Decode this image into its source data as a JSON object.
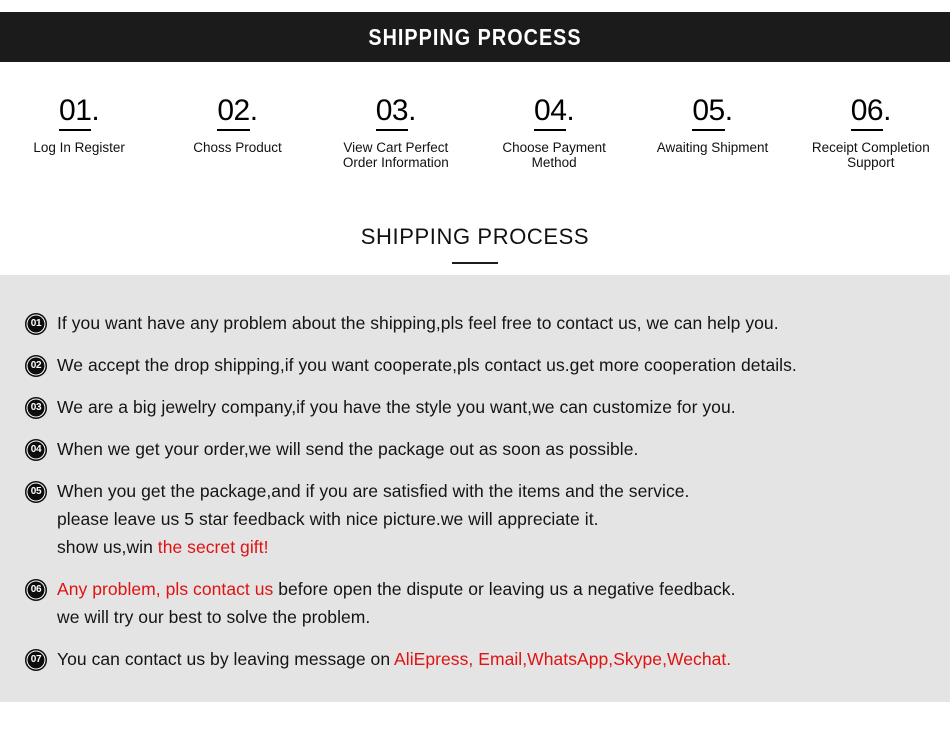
{
  "banner": {
    "title": "SHIPPING PROCESS"
  },
  "steps": [
    {
      "number": "01",
      "dot": ".",
      "label": "Log In Register"
    },
    {
      "number": "02",
      "dot": ".",
      "label": "Choss Product"
    },
    {
      "number": "03",
      "dot": ".",
      "label": "View Cart Perfect\nOrder Information"
    },
    {
      "number": "04",
      "dot": ".",
      "label": "Choose Payment\nMethod"
    },
    {
      "number": "05",
      "dot": ".",
      "label": "Awaiting Shipment"
    },
    {
      "number": "06",
      "dot": ".",
      "label": "Receipt Completion\nSupport"
    }
  ],
  "section": {
    "subtitle": "SHIPPING PROCESS"
  },
  "colors": {
    "banner_background": "#1b1b1b",
    "panel_background": "#e4e4e4",
    "accent_red": "#e01212",
    "badge_background": "#0d0d0d"
  },
  "notes": [
    {
      "badge": "01",
      "lines": [
        [
          {
            "text": "If you want have any problem about the shipping,pls feel free to contact us, we can help you.",
            "color": "black"
          }
        ]
      ]
    },
    {
      "badge": "02",
      "lines": [
        [
          {
            "text": "We accept the drop shipping,if you want cooperate,pls contact us.get more cooperation details.",
            "color": "black"
          }
        ]
      ]
    },
    {
      "badge": "03",
      "lines": [
        [
          {
            "text": "We are a big jewelry company,if you have the style you want,we can customize for you.",
            "color": "black"
          }
        ]
      ]
    },
    {
      "badge": "04",
      "lines": [
        [
          {
            "text": "When we get your order,we will send the package out as soon as possible.",
            "color": "black"
          }
        ]
      ]
    },
    {
      "badge": "05",
      "lines": [
        [
          {
            "text": "When you get the package,and if you are satisfied with the items and the service.",
            "color": "black"
          }
        ],
        [
          {
            "text": "please leave us 5 star feedback with nice picture.we will appreciate it.",
            "color": "black"
          }
        ],
        [
          {
            "text": "show us,win ",
            "color": "black"
          },
          {
            "text": "the secret gift!",
            "color": "red"
          }
        ]
      ]
    },
    {
      "badge": "06",
      "lines": [
        [
          {
            "text": "Any problem, pls contact us",
            "color": "red"
          },
          {
            "text": " before open the dispute or leaving us a negative feedback.",
            "color": "black"
          }
        ],
        [
          {
            "text": "we will try our best to solve the problem.",
            "color": "black"
          }
        ]
      ]
    },
    {
      "badge": "07",
      "lines": [
        [
          {
            "text": "You can contact us by leaving message on ",
            "color": "black"
          },
          {
            "text": "AliEpress, Email,WhatsApp,Skype,Wechat.",
            "color": "red"
          }
        ]
      ]
    }
  ]
}
